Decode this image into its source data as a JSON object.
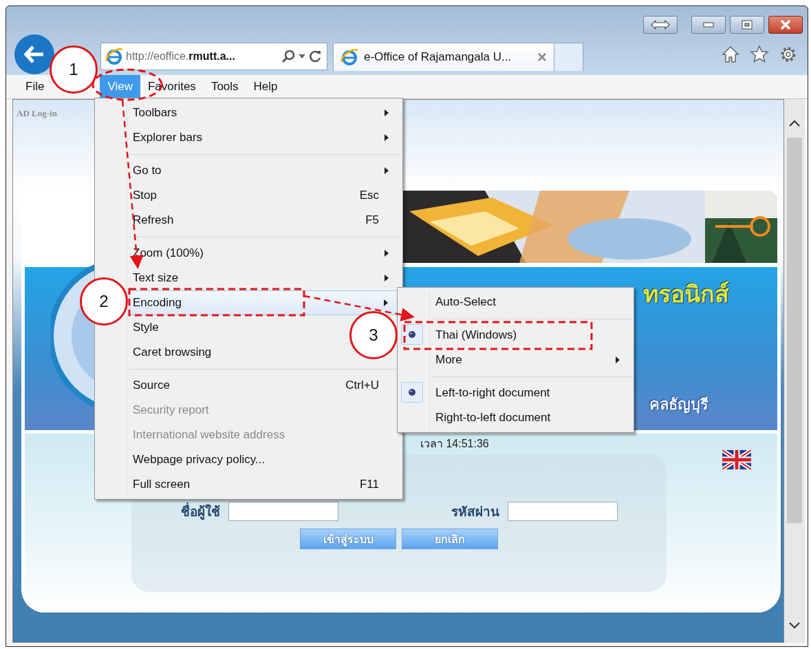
{
  "address_bar": {
    "url": "http://eoffice.**rmutt.a...**"
  },
  "tabs": [
    {
      "label": "e-Office of Rajamangala U...",
      "selected": true
    }
  ],
  "menu_bar": [
    {
      "label": "File",
      "selected": false
    },
    {
      "label": "View",
      "selected": true
    },
    {
      "label": "Favorites",
      "selected": false
    },
    {
      "label": "Tools",
      "selected": false
    },
    {
      "label": "Help",
      "selected": false
    }
  ],
  "view_menu": [
    {
      "kind": "item",
      "label": "Toolbars",
      "submenu": true,
      "disabled": false,
      "selected": false
    },
    {
      "kind": "item",
      "label": "Explorer bars",
      "submenu": true,
      "disabled": false,
      "selected": false
    },
    {
      "kind": "separator"
    },
    {
      "kind": "item",
      "label": "Go to",
      "submenu": true,
      "disabled": false,
      "selected": false
    },
    {
      "kind": "item",
      "label": "Stop",
      "shortcut": "Esc",
      "submenu": false,
      "disabled": false,
      "selected": false
    },
    {
      "kind": "item",
      "label": "Refresh",
      "shortcut": "F5",
      "submenu": false,
      "disabled": false,
      "selected": false
    },
    {
      "kind": "separator"
    },
    {
      "kind": "item",
      "label": "Zoom (100%)",
      "submenu": true,
      "disabled": false,
      "selected": false
    },
    {
      "kind": "item",
      "label": "Text size",
      "submenu": true,
      "disabled": false,
      "selected": false
    },
    {
      "kind": "item",
      "label": "Encoding",
      "submenu": true,
      "disabled": false,
      "selected": true
    },
    {
      "kind": "item",
      "label": "Style",
      "submenu": false,
      "disabled": false,
      "selected": false
    },
    {
      "kind": "item",
      "label": "Caret browsing",
      "submenu": false,
      "disabled": false,
      "selected": false
    },
    {
      "kind": "separator"
    },
    {
      "kind": "item",
      "label": "Source",
      "shortcut": "Ctrl+U",
      "submenu": false,
      "disabled": false,
      "selected": false
    },
    {
      "kind": "item",
      "label": "Security report",
      "submenu": false,
      "disabled": true,
      "selected": false
    },
    {
      "kind": "item",
      "label": "International website address",
      "submenu": false,
      "disabled": true,
      "selected": false
    },
    {
      "kind": "item",
      "label": "Webpage privacy policy...",
      "submenu": false,
      "disabled": false,
      "selected": false
    },
    {
      "kind": "item",
      "label": "Full screen",
      "shortcut": "F11",
      "submenu": false,
      "disabled": false,
      "selected": false
    }
  ],
  "encoding_menu": [
    {
      "kind": "item",
      "label": "Auto-Select",
      "checked": false,
      "submenu": false
    },
    {
      "kind": "separator"
    },
    {
      "kind": "item",
      "label": "Thai (Windows)",
      "checked": true,
      "submenu": false
    },
    {
      "kind": "item",
      "label": "More",
      "checked": false,
      "submenu": true
    },
    {
      "kind": "separator"
    },
    {
      "kind": "item",
      "label": "Left-to-right document",
      "checked": true,
      "submenu": false
    },
    {
      "kind": "item",
      "label": "Right-to-left document",
      "checked": false,
      "submenu": false
    }
  ],
  "page": {
    "ad_login": "AD Log-in",
    "banner_title": "ทรอนิกส์",
    "banner_subtitle": "คลธัญบุรี",
    "clock": "เวลา 14:51:36",
    "username_label": "ชื่อผู้ใช้",
    "password_label": "รหัสผ่าน",
    "login_button": "เข้าสู่ระบบ",
    "cancel_button": "ยกเลิก"
  },
  "annotations": [
    {
      "label": "1"
    },
    {
      "label": "2"
    },
    {
      "label": "3"
    }
  ]
}
